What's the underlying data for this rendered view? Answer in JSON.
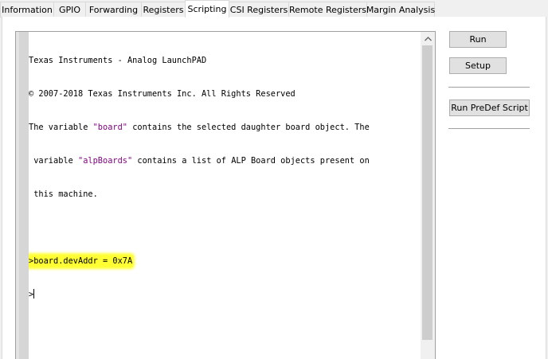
{
  "tabs": [
    {
      "label": "Information"
    },
    {
      "label": "GPIO"
    },
    {
      "label": "Forwarding"
    },
    {
      "label": "Registers"
    },
    {
      "label": "Scripting",
      "active": true
    },
    {
      "label": "CSI Registers"
    },
    {
      "label": "Remote Registers"
    },
    {
      "label": "Margin Analysis"
    }
  ],
  "console": {
    "header_line1": "Texas Instruments - Analog LaunchPAD",
    "header_line2": "© 2007-2018 Texas Instruments Inc. All Rights Reserved",
    "intro_a": "The variable ",
    "intro_board": "\"board\"",
    "intro_b": " contains the selected daughter board object. The",
    "intro_c": " variable ",
    "intro_alp": "\"alpBoards\"",
    "intro_d": " contains a list of ALP Board objects present on",
    "intro_e": " this machine.",
    "command": ">board.devAddr = 0x7A",
    "prompt": ">"
  },
  "buttons": {
    "run": "Run",
    "setup": "Setup",
    "run_predef": "Run PreDef Script"
  },
  "colors": {
    "string_literal": "#7f007f",
    "highlight": "#ffff33"
  },
  "icons": {
    "scroll_up": "chevron-up-icon"
  }
}
